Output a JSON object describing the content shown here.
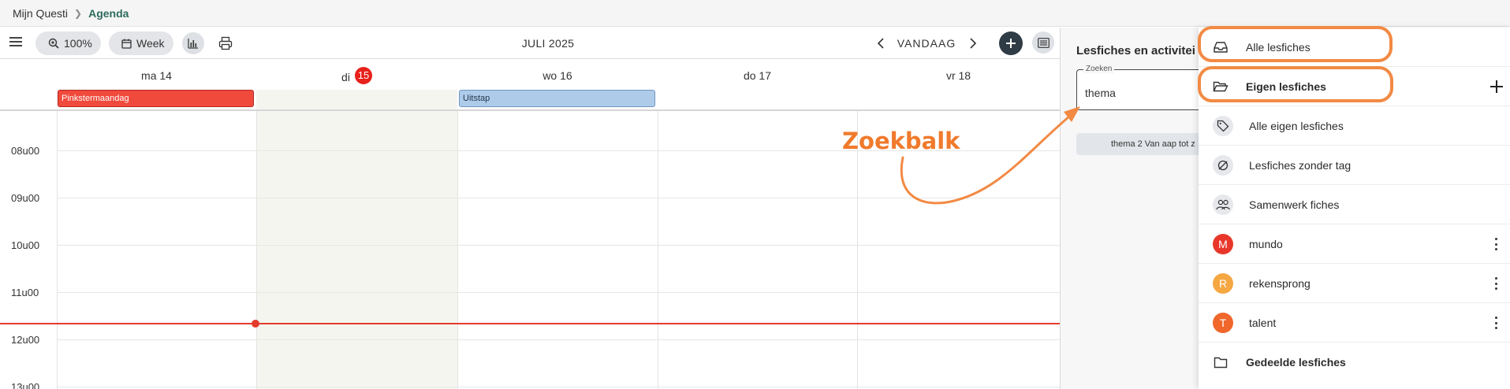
{
  "breadcrumb": {
    "home": "Mijn Questi",
    "current": "Agenda"
  },
  "toolbar": {
    "zoom_label": "100%",
    "view_label": "Week",
    "month_label": "JULI 2025",
    "today_label": "VANDAAG"
  },
  "calendar": {
    "days": [
      {
        "label": "ma 14"
      },
      {
        "label": "di",
        "badge": "15"
      },
      {
        "label": "wo 16"
      },
      {
        "label": "do 17"
      },
      {
        "label": "vr 18"
      }
    ],
    "allday_events": [
      {
        "title": "Pinkstermaandag",
        "day": "ma 14",
        "color": "#f04a3c"
      },
      {
        "title": "Uitstap",
        "day": "wo 16",
        "color": "#aecbea"
      }
    ],
    "hours": [
      "08u00",
      "09u00",
      "10u00",
      "11u00",
      "12u00",
      "13u00"
    ],
    "now_color": "#e43b2c"
  },
  "panel": {
    "title": "Lesfiches en activitei",
    "search": {
      "label": "Zoeken",
      "value": "thema"
    },
    "result": "thema 2 Van aap tot z"
  },
  "menu": {
    "items": [
      {
        "label": "Alle lesfiches",
        "icon": "inbox-icon"
      },
      {
        "label": "Eigen lesfiches",
        "icon": "folder-open-icon"
      },
      {
        "label": "Alle eigen lesfiches",
        "icon": "tag-icon"
      },
      {
        "label": "Lesfiches zonder tag",
        "icon": "no-tag-icon"
      },
      {
        "label": "Samenwerk fiches",
        "icon": "users-icon"
      },
      {
        "label": "mundo",
        "avatar": "M",
        "color": "#e8372a"
      },
      {
        "label": "rekensprong",
        "avatar": "R",
        "color": "#f5a742"
      },
      {
        "label": "talent",
        "avatar": "T",
        "color": "#f0662b"
      },
      {
        "label": "Gedeelde lesfiches",
        "icon": "folder-icon"
      }
    ]
  },
  "annotation": {
    "text": "Zoekbalk",
    "color": "#f07a2c"
  }
}
